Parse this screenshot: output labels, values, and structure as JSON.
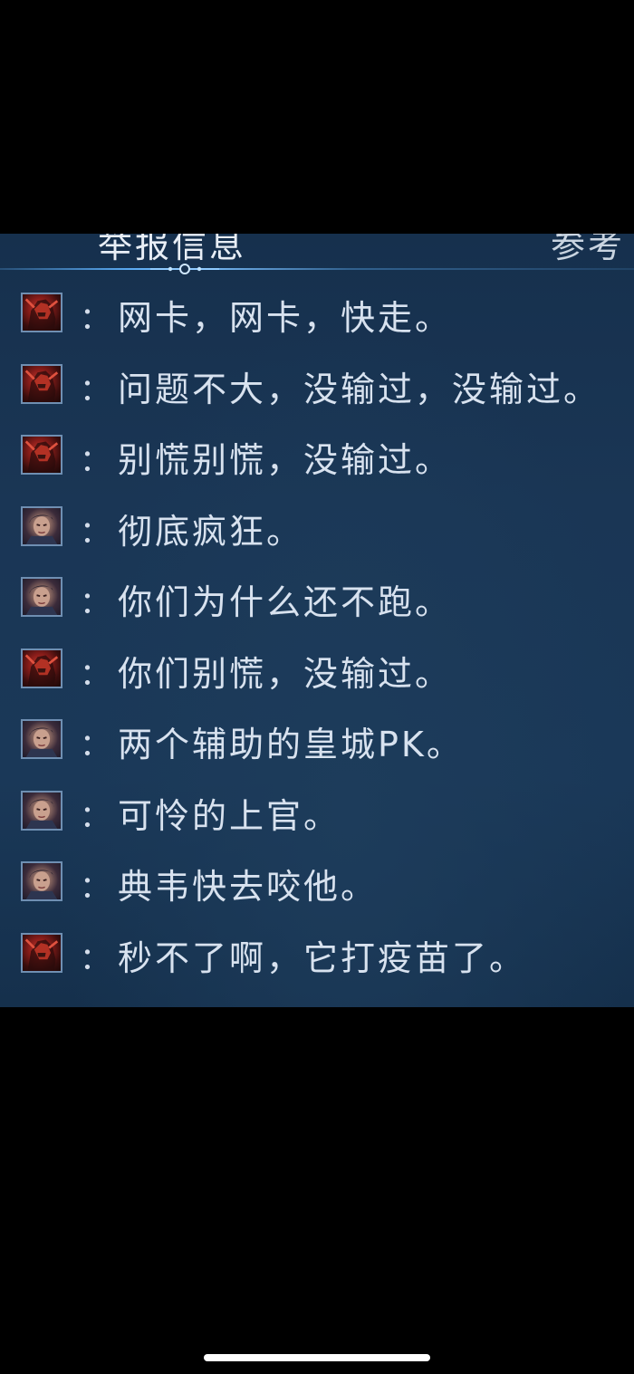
{
  "header": {
    "title": "举报信息",
    "reference_label": "参考"
  },
  "messages": [
    {
      "avatar": "hero-a-avatar",
      "text": "网卡，网卡，快走。"
    },
    {
      "avatar": "hero-a-avatar",
      "text": "问题不大，没输过，没输过。"
    },
    {
      "avatar": "hero-a-avatar",
      "text": "别慌别慌，没输过。"
    },
    {
      "avatar": "hero-b-avatar",
      "text": "彻底疯狂。"
    },
    {
      "avatar": "hero-b-avatar",
      "text": "你们为什么还不跑。"
    },
    {
      "avatar": "hero-a-avatar",
      "text": "你们别慌，没输过。"
    },
    {
      "avatar": "hero-b-avatar",
      "text": "两个辅助的皇城PK。"
    },
    {
      "avatar": "hero-b-avatar",
      "text": "可怜的上官。"
    },
    {
      "avatar": "hero-b-avatar",
      "text": "典韦快去咬他。"
    },
    {
      "avatar": "hero-a-avatar",
      "text": "秒不了啊，它打疫苗了。"
    }
  ],
  "separator": "：",
  "colors": {
    "panel_background": "#1a3655",
    "text": "#d8e2ef",
    "accent_line": "#59a8f0",
    "avatar_border": "#6f8fb2"
  }
}
